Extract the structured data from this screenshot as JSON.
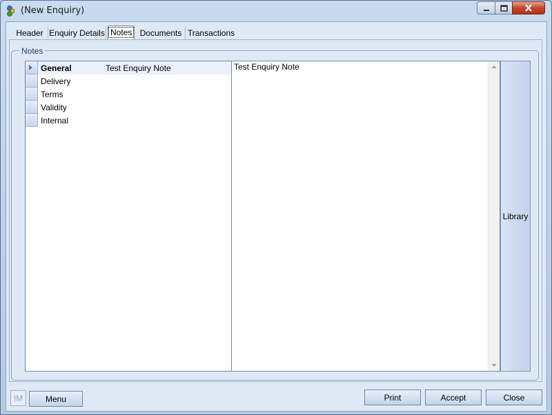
{
  "window": {
    "title": "(New Enquiry)",
    "icons": {
      "app": "app-icon",
      "min": "minimize-icon",
      "max": "maximize-icon",
      "close": "close-icon"
    }
  },
  "tabs": [
    {
      "label": "Header"
    },
    {
      "label": "Enquiry Details"
    },
    {
      "label": "Notes",
      "active": true
    },
    {
      "label": "Documents"
    },
    {
      "label": "Transactions"
    }
  ],
  "notes": {
    "group_label": "Notes",
    "rows": [
      {
        "name": "General",
        "note": "Test Enquiry Note",
        "selected": true
      },
      {
        "name": "Delivery",
        "note": ""
      },
      {
        "name": "Terms",
        "note": ""
      },
      {
        "name": "Validity",
        "note": ""
      },
      {
        "name": "Internal",
        "note": ""
      }
    ],
    "text": "Test Enquiry Note",
    "library_label": "Library"
  },
  "footer": {
    "logo": "IM",
    "menu_label": "Menu",
    "print_label": "Print",
    "accept_label": "Accept",
    "close_label": "Close"
  }
}
